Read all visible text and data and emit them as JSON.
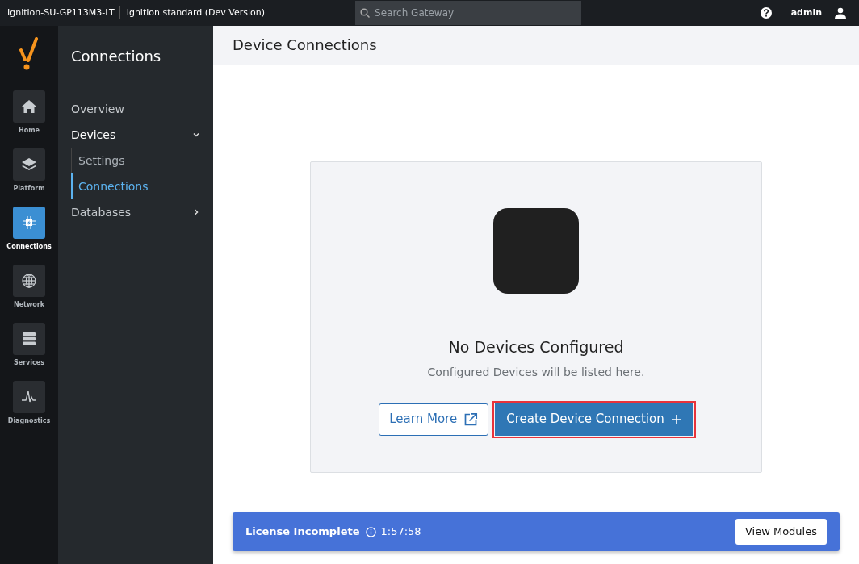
{
  "topbar": {
    "gateway_name": "Ignition-SU-GP113M3-LT",
    "edition": "Ignition standard (Dev Version)",
    "search": {
      "placeholder": "Search Gateway"
    },
    "user": "admin"
  },
  "rail": [
    {
      "kind": "home",
      "label": "Home",
      "selected": false
    },
    {
      "kind": "platform",
      "label": "Platform",
      "selected": false
    },
    {
      "kind": "connections",
      "label": "Connections",
      "selected": true
    },
    {
      "kind": "network",
      "label": "Network",
      "selected": false
    },
    {
      "kind": "services",
      "label": "Services",
      "selected": false
    },
    {
      "kind": "diagnostics",
      "label": "Diagnostics",
      "selected": false
    }
  ],
  "nav": {
    "title": "Connections",
    "items": [
      {
        "label": "Overview",
        "selected": false
      },
      {
        "label": "Devices",
        "expanded": true,
        "selected": false,
        "children": [
          {
            "label": "Settings",
            "selected": false
          },
          {
            "label": "Connections",
            "selected": true
          }
        ]
      },
      {
        "label": "Databases",
        "expanded": false,
        "selected": false
      }
    ]
  },
  "page_title": "Device Connections",
  "empty_state": {
    "title": "No Devices Configured",
    "message": "Configured Devices will be listed here.",
    "buttons": [
      {
        "kind": "outline",
        "label": "Learn More",
        "highlighted": false
      },
      {
        "kind": "primary",
        "label": "Create Device Connection",
        "highlighted": true
      }
    ]
  },
  "license_banner": {
    "title": "License Incomplete",
    "time": "1:57:58",
    "button": "View Modules"
  }
}
